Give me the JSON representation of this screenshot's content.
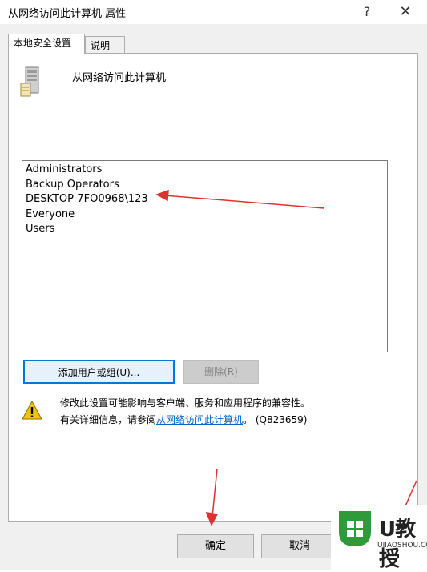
{
  "window": {
    "title": "从网络访问此计算机 属性",
    "help_glyph": "?",
    "close_glyph": "✕"
  },
  "tabs": [
    {
      "label": "本地安全设置",
      "active": true
    },
    {
      "label": "说明",
      "active": false
    }
  ],
  "policy": {
    "name": "从网络访问此计算机",
    "icon": "server-icon"
  },
  "members": [
    "Administrators",
    "Backup Operators",
    "DESKTOP-7FO0968\\123",
    "Everyone",
    "Users"
  ],
  "buttons": {
    "add": "添加用户或组(U)...",
    "remove": "删除(R)",
    "ok": "确定",
    "cancel": "取消"
  },
  "warning": {
    "icon": "warning-icon",
    "line1": "修改此设置可能影响与客户端、服务和应用程序的兼容性。",
    "line2_prefix": "有关详细信息，请参阅",
    "link": "从网络访问此计算机",
    "line2_suffix": "。 (Q823659)"
  },
  "watermark": {
    "brand": "U教授",
    "url": "UJIAOSHOU.COM"
  },
  "colors": {
    "annotation_arrow": "#e03030",
    "focus_border": "#0078d7",
    "link": "#0066cc",
    "logo_green": "#2e9a3a"
  }
}
